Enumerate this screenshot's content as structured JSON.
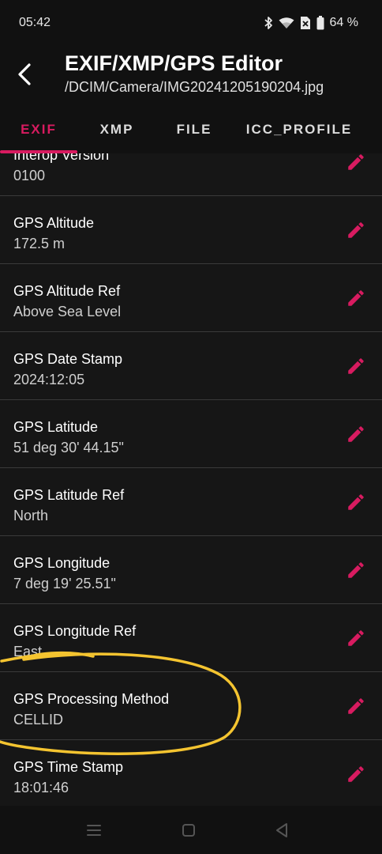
{
  "status_bar": {
    "time": "05:42",
    "battery_percent": "64 %",
    "icons": [
      "bluetooth-icon",
      "wifi-icon",
      "sim-off-icon",
      "battery-icon"
    ]
  },
  "app_bar": {
    "title": "EXIF/XMP/GPS Editor",
    "subtitle": "/DCIM/Camera/IMG20241205190204.jpg"
  },
  "tabs": [
    {
      "label": "EXIF",
      "active": true
    },
    {
      "label": "XMP",
      "active": false
    },
    {
      "label": "FILE",
      "active": false
    },
    {
      "label": "ICC_PROFILE",
      "active": false
    }
  ],
  "colors": {
    "accent": "#d81b60",
    "background": "#161616",
    "bar": "#111111",
    "divider": "#3a3a3a",
    "annotation": "#f4c430"
  },
  "rows": [
    {
      "label": "Interop Version",
      "value": "0100"
    },
    {
      "label": "GPS Altitude",
      "value": "172.5 m"
    },
    {
      "label": "GPS Altitude Ref",
      "value": "Above Sea Level"
    },
    {
      "label": "GPS Date Stamp",
      "value": "2024:12:05"
    },
    {
      "label": "GPS Latitude",
      "value": "51 deg 30' 44.15\""
    },
    {
      "label": "GPS Latitude Ref",
      "value": "North"
    },
    {
      "label": "GPS Longitude",
      "value": "7 deg 19' 25.51\""
    },
    {
      "label": "GPS Longitude Ref",
      "value": "East"
    },
    {
      "label": "GPS Processing Method",
      "value": "CELLID"
    },
    {
      "label": "GPS Time Stamp",
      "value": "18:01:46"
    }
  ]
}
